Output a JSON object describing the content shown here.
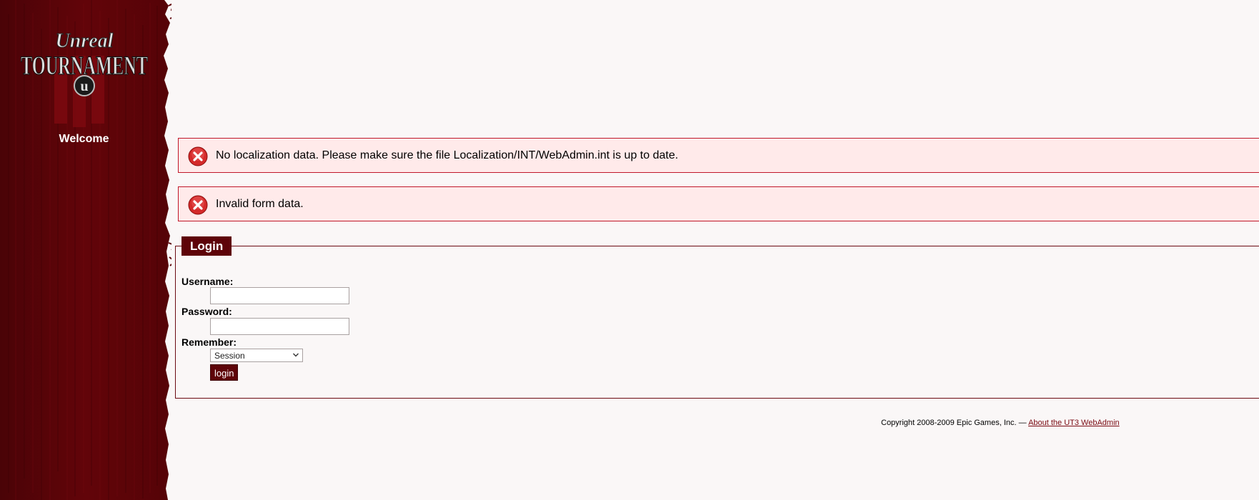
{
  "app": {
    "logo_text": "Unreal Tournament",
    "welcome": "Welcome"
  },
  "colors": {
    "sidebar": "#5e0409",
    "sidebar_dark": "#3a0205",
    "error_border": "#c0182a",
    "error_bg": "#ffeaea",
    "accent": "#5e0409",
    "page_bg": "#faf7f7"
  },
  "messages": [
    {
      "icon": "error-icon",
      "text": "No localization data. Please make sure the file Localization/INT/WebAdmin.int is up to date."
    },
    {
      "icon": "error-icon",
      "text": "Invalid form data."
    }
  ],
  "login": {
    "legend": "Login",
    "username_label": "Username:",
    "username_value": "",
    "password_label": "Password:",
    "password_value": "",
    "remember_label": "Remember:",
    "remember_selected": "Session",
    "submit_label": "login"
  },
  "footer": {
    "copyright": "Copyright 2008-2009 Epic Games, Inc. — ",
    "about_link": "About the UT3 WebAdmin"
  }
}
